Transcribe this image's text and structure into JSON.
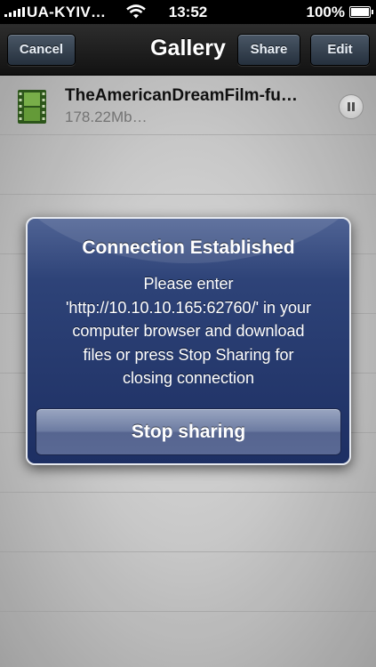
{
  "status_bar": {
    "carrier": "UA-KYIV…",
    "time": "13:52",
    "battery": "100%",
    "icons": [
      "signal-icon",
      "wifi-icon",
      "battery-icon"
    ]
  },
  "nav": {
    "title": "Gallery",
    "cancel_label": "Cancel",
    "share_label": "Share",
    "edit_label": "Edit"
  },
  "files": [
    {
      "name": "TheAmericanDreamFilm-fu…",
      "size": "178.22Mb…",
      "icon": "film-icon",
      "action_icon": "pause-icon"
    }
  ],
  "alert": {
    "title": "Connection Established",
    "message": "Please enter\n'http://10.10.10.165:62760/' in your\ncomputer browser and download\nfiles or press Stop Sharing for\nclosing connection",
    "button_label": "Stop sharing"
  },
  "colors": {
    "nav_bar": "#1c1c1c",
    "alert_bg": "#2e4378",
    "file_icon": "#4f8f2f"
  }
}
